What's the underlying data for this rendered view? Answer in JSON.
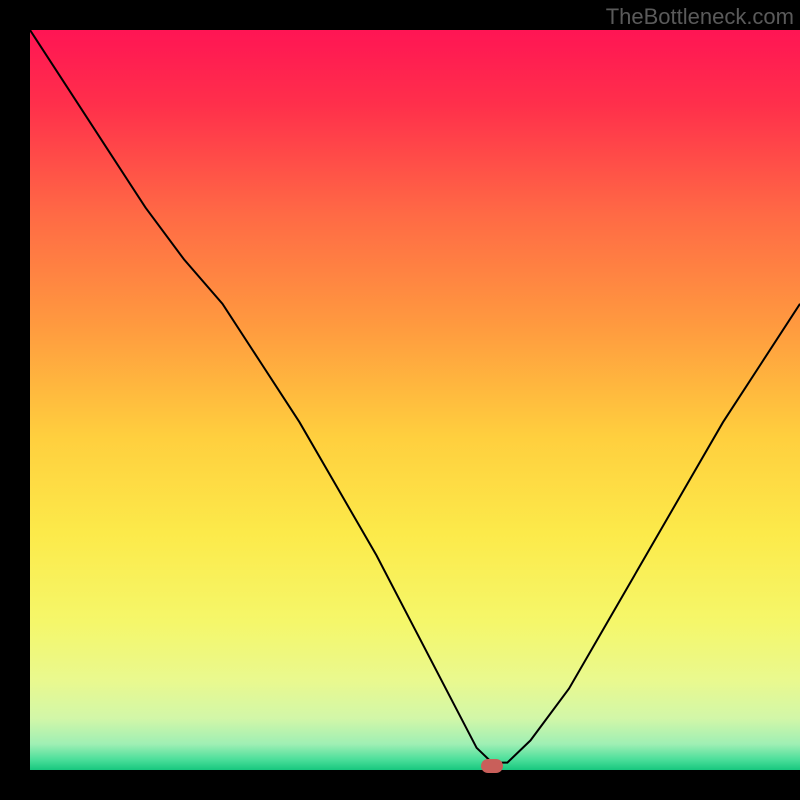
{
  "watermark": "TheBottleneck.com",
  "chart_data": {
    "type": "line",
    "title": "",
    "xlabel": "",
    "ylabel": "",
    "xlim": [
      0,
      100
    ],
    "ylim": [
      0,
      100
    ],
    "series": [
      {
        "name": "bottleneck-curve",
        "x": [
          0,
          5,
          10,
          15,
          20,
          25,
          30,
          35,
          40,
          45,
          50,
          55,
          58,
          60,
          62,
          65,
          70,
          75,
          80,
          85,
          90,
          95,
          100
        ],
        "values": [
          100,
          92,
          84,
          76,
          69,
          63,
          55,
          47,
          38,
          29,
          19,
          9,
          3,
          1,
          1,
          4,
          11,
          20,
          29,
          38,
          47,
          55,
          63
        ]
      }
    ],
    "marker": {
      "x": 60,
      "y": 0.5
    },
    "gradient_stops": [
      {
        "offset": 0.0,
        "color": "#ff1554"
      },
      {
        "offset": 0.1,
        "color": "#ff2f4b"
      },
      {
        "offset": 0.25,
        "color": "#ff6a45"
      },
      {
        "offset": 0.4,
        "color": "#ff9a3f"
      },
      {
        "offset": 0.55,
        "color": "#ffcf3e"
      },
      {
        "offset": 0.68,
        "color": "#fcea4a"
      },
      {
        "offset": 0.8,
        "color": "#f5f76a"
      },
      {
        "offset": 0.88,
        "color": "#e9f98f"
      },
      {
        "offset": 0.93,
        "color": "#d2f7a8"
      },
      {
        "offset": 0.965,
        "color": "#9fefb4"
      },
      {
        "offset": 0.985,
        "color": "#4fe09c"
      },
      {
        "offset": 1.0,
        "color": "#18c77e"
      }
    ]
  }
}
